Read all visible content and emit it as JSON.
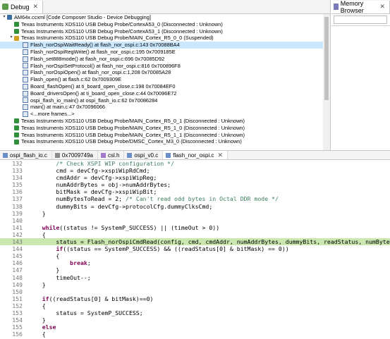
{
  "debug": {
    "tab_label": "Debug",
    "close": "✕",
    "tree": [
      {
        "level": 0,
        "icon": "launch",
        "twisty": "▾",
        "text": "AM64x.ccxml [Code Composer Studio - Device Debugging]"
      },
      {
        "level": 1,
        "icon": "thread",
        "twisty": "",
        "text": "Texas Instruments XDS110 USB Debug Probe/CortexA53_0 (Disconnected : Unknown)"
      },
      {
        "level": 1,
        "icon": "thread",
        "twisty": "",
        "text": "Texas Instruments XDS110 USB Debug Probe/CortexA53_1 (Disconnected : Unknown)"
      },
      {
        "level": 1,
        "icon": "thread-s",
        "twisty": "▾",
        "text": "Texas Instruments XDS110 USB Debug Probe/MAIN_Cortex_R5_0_0 (Suspended)"
      },
      {
        "level": 2,
        "icon": "frame",
        "twisty": "",
        "text": "Flash_norOspiWaitReady() at flash_nor_ospi.c:143 0x70088BA4",
        "selected": true
      },
      {
        "level": 2,
        "icon": "frame",
        "twisty": "",
        "text": "Flash_norOspiRegWrite() at flash_nor_ospi.c:195 0x7009185E"
      },
      {
        "level": 2,
        "icon": "frame",
        "twisty": "",
        "text": "Flash_set888mode() at flash_nor_ospi.c:696 0x70085D92"
      },
      {
        "level": 2,
        "icon": "frame",
        "twisty": "",
        "text": "Flash_norOspiSetProtocol() at flash_nor_ospi.c:816 0x700896F8"
      },
      {
        "level": 2,
        "icon": "frame",
        "twisty": "",
        "text": "Flash_norOspiOpen() at flash_nor_ospi.c:1,208 0x70085A28"
      },
      {
        "level": 2,
        "icon": "frame",
        "twisty": "",
        "text": "Flash_open() at flash.c:62 0x7009309E"
      },
      {
        "level": 2,
        "icon": "frame",
        "twisty": "",
        "text": "Board_flashOpen() at ti_board_open_close.c:198 0x70084EF0"
      },
      {
        "level": 2,
        "icon": "frame",
        "twisty": "",
        "text": "Board_driversOpen() at ti_board_open_close.c:44 0x70096E72"
      },
      {
        "level": 2,
        "icon": "frame",
        "twisty": "",
        "text": "ospi_flash_io_main() at ospi_flash_io.c:62 0x70086284"
      },
      {
        "level": 2,
        "icon": "frame",
        "twisty": "",
        "text": "main() at main.c:47 0x70096066"
      },
      {
        "level": 2,
        "icon": "frame",
        "twisty": "",
        "text": "<...more frames...>"
      },
      {
        "level": 1,
        "icon": "thread",
        "twisty": "",
        "text": "Texas Instruments XDS110 USB Debug Probe/MAIN_Cortex_R5_0_1 (Disconnected : Unknown)"
      },
      {
        "level": 1,
        "icon": "thread",
        "twisty": "",
        "text": "Texas Instruments XDS110 USB Debug Probe/MAIN_Cortex_R5_1_0 (Disconnected : Unknown)"
      },
      {
        "level": 1,
        "icon": "thread",
        "twisty": "",
        "text": "Texas Instruments XDS110 USB Debug Probe/MAIN_Cortex_R5_1_1 (Disconnected : Unknown)"
      },
      {
        "level": 1,
        "icon": "thread",
        "twisty": "",
        "text": "Texas Instruments XDS110 USB Debug Probe/DMSC_Cortex_M3_0 (Disconnected : Unknown)"
      }
    ]
  },
  "memory": {
    "tab_label": "Memory Browser",
    "close": "✕"
  },
  "editor": {
    "tabs": [
      {
        "label": "ospi_flash_io.c",
        "icon": "c",
        "active": false
      },
      {
        "label": "0x7009749a",
        "icon": "bin",
        "active": false
      },
      {
        "label": "csl.h",
        "icon": "h",
        "active": false
      },
      {
        "label": "ospi_v0.c",
        "icon": "c",
        "active": false
      },
      {
        "label": "flash_nor_ospi.c",
        "icon": "c",
        "active": true,
        "close": "✕"
      }
    ],
    "lines": [
      {
        "n": "132",
        "code": "        /* Check XSPI WIP configuration */",
        "type": "comment"
      },
      {
        "n": "133",
        "code": "        cmd = devCfg->xspiWipRdCmd;"
      },
      {
        "n": "134",
        "code": "        cmdAddr = devCfg->xspiWipReg;"
      },
      {
        "n": "135",
        "code": "        numAddrBytes = obj->numAddrBytes;"
      },
      {
        "n": "136",
        "code": "        bitMask = devCfg->xspiWipBit;"
      },
      {
        "n": "137",
        "code": "        numBytesToRead = 2; ",
        "comment": "/* Can't read odd bytes in Octal DDR mode */"
      },
      {
        "n": "138",
        "code": "        dummyBits = devCfg->protocolCfg.dummyClksCmd;"
      },
      {
        "n": "139",
        "code": "    }"
      },
      {
        "n": "140",
        "code": ""
      },
      {
        "n": "141",
        "code": "    while((status != SystemP_SUCCESS) || (timeOut > 0))",
        "kw": "while"
      },
      {
        "n": "142",
        "code": "    {"
      },
      {
        "n": "143",
        "code": "        status = Flash_norOspiCmdRead(config, cmd, cmdAddr, numAddrBytes, dummyBits, readStatus, numBytesToRead);",
        "current": true
      },
      {
        "n": "144",
        "code": "        if((status == SystemP_SUCCESS) && ((readStatus[0] & bitMask) == 0))",
        "kw": "if"
      },
      {
        "n": "145",
        "code": "        {"
      },
      {
        "n": "146",
        "code": "            break;",
        "kw": "break"
      },
      {
        "n": "147",
        "code": "        }"
      },
      {
        "n": "148",
        "code": "        timeOut--;"
      },
      {
        "n": "149",
        "code": "    }"
      },
      {
        "n": "150",
        "code": ""
      },
      {
        "n": "151",
        "code": "    if((readStatus[0] & bitMask)==0)",
        "kw": "if"
      },
      {
        "n": "152",
        "code": "    {"
      },
      {
        "n": "153",
        "code": "        status = SystemP_SUCCESS;"
      },
      {
        "n": "154",
        "code": "    }"
      },
      {
        "n": "155",
        "code": "    else",
        "kw": "else"
      },
      {
        "n": "156",
        "code": "    {"
      }
    ]
  },
  "colors": {
    "selection": "#cce8ff",
    "current_line": "#cbe7b0",
    "keyword": "#7f0055",
    "comment": "#3f7f5f"
  }
}
